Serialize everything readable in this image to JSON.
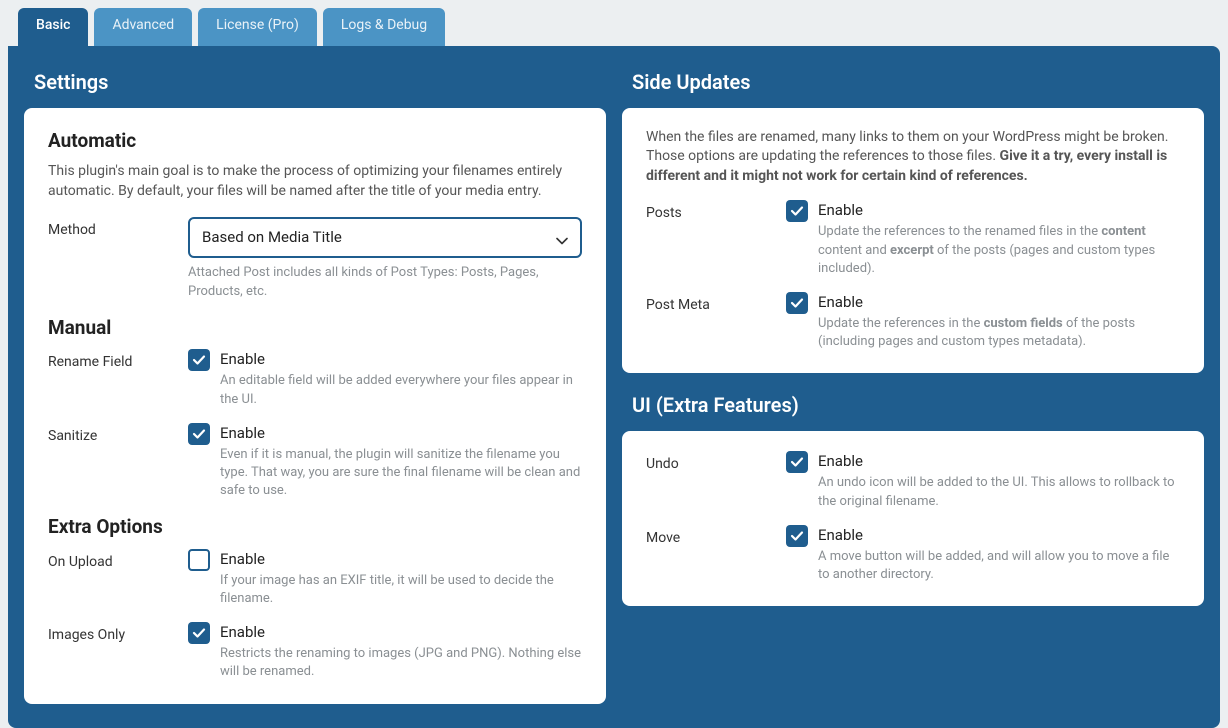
{
  "tabs": [
    {
      "label": "Basic",
      "active": true
    },
    {
      "label": "Advanced",
      "active": false
    },
    {
      "label": "License (Pro)",
      "active": false
    },
    {
      "label": "Logs & Debug",
      "active": false
    }
  ],
  "left": {
    "title": "Settings",
    "automatic": {
      "heading": "Automatic",
      "desc": "This plugin's main goal is to make the process of optimizing your filenames entirely automatic. By default, your files will be named after the title of your media entry.",
      "method_label": "Method",
      "method_value": "Based on Media Title",
      "method_helper": "Attached Post includes all kinds of Post Types: Posts, Pages, Products, etc."
    },
    "manual": {
      "heading": "Manual",
      "rename_field": {
        "label": "Rename Field",
        "enable": "Enable",
        "desc": "An editable field will be added everywhere your files appear in the UI.",
        "checked": true
      },
      "sanitize": {
        "label": "Sanitize",
        "enable": "Enable",
        "desc": "Even if it is manual, the plugin will sanitize the filename you type. That way, you are sure the final filename will be clean and safe to use.",
        "checked": true
      }
    },
    "extra": {
      "heading": "Extra Options",
      "on_upload": {
        "label": "On Upload",
        "enable": "Enable",
        "desc": "If your image has an EXIF title, it will be used to decide the filename.",
        "checked": false
      },
      "images_only": {
        "label": "Images Only",
        "enable": "Enable",
        "desc": "Restricts the renaming to images (JPG and PNG). Nothing else will be renamed.",
        "checked": true
      }
    }
  },
  "right": {
    "side_updates": {
      "title": "Side Updates",
      "intro_plain": "When the files are renamed, many links to them on your WordPress might be broken. Those options are updating the references to those files. ",
      "intro_bold": "Give it a try, every install is different and it might not work for certain kind of references.",
      "posts": {
        "label": "Posts",
        "enable": "Enable",
        "desc_pre": "Update the references to the renamed files in the ",
        "desc_b1": "content",
        "desc_mid": " content and ",
        "desc_b2": "excerpt",
        "desc_post": " of the posts (pages and custom types included).",
        "checked": true
      },
      "post_meta": {
        "label": "Post Meta",
        "enable": "Enable",
        "desc_pre": "Update the references in the ",
        "desc_b1": "custom fields",
        "desc_post": " of the posts (including pages and custom types metadata).",
        "checked": true
      }
    },
    "ui": {
      "title": "UI (Extra Features)",
      "undo": {
        "label": "Undo",
        "enable": "Enable",
        "desc": "An undo icon will be added to the UI. This allows to rollback to the original filename.",
        "checked": true
      },
      "move": {
        "label": "Move",
        "enable": "Enable",
        "desc": "A move button will be added, and will allow you to move a file to another directory.",
        "checked": true
      }
    }
  }
}
